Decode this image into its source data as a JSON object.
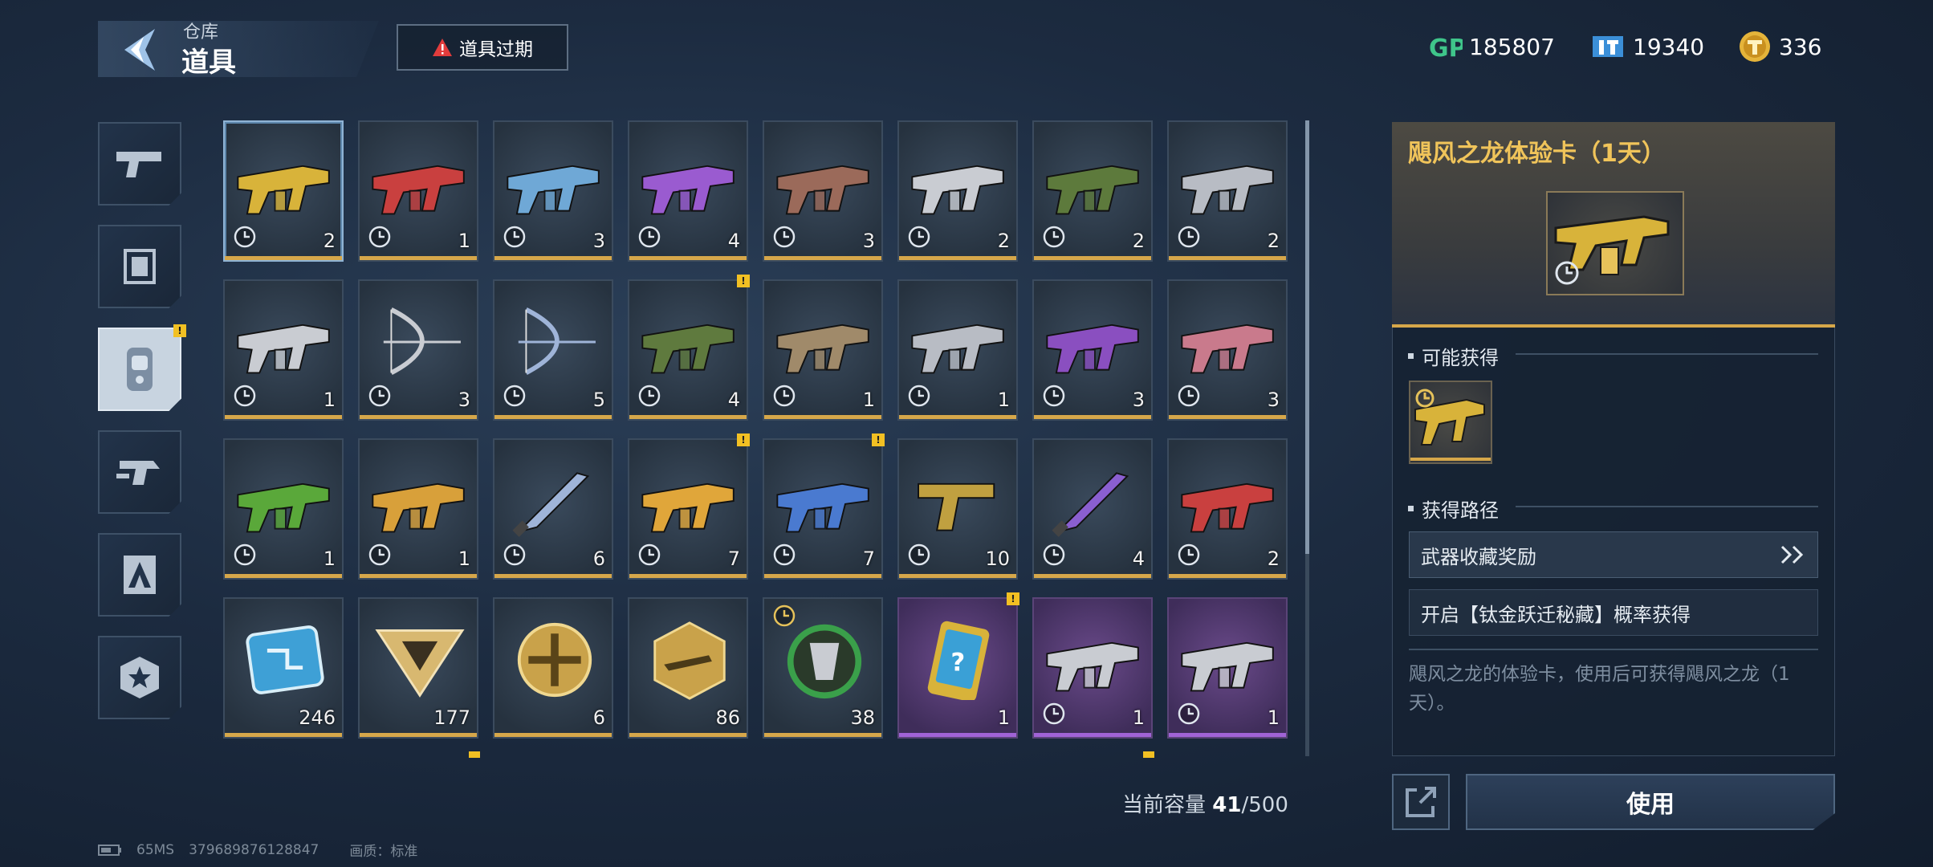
{
  "header": {
    "crumb_parent": "仓库",
    "crumb_current": "道具",
    "expire_button": "道具过期",
    "currencies": [
      {
        "icon": "gp-icon",
        "value": "185807"
      },
      {
        "icon": "ticket-icon",
        "value": "19340"
      },
      {
        "icon": "gold-coin-icon",
        "value": "336"
      }
    ]
  },
  "sidebar": {
    "tabs": [
      {
        "icon": "pistol-icon"
      },
      {
        "icon": "skin-frame-icon"
      },
      {
        "icon": "item-card-icon",
        "active": true
      },
      {
        "icon": "spray-icon"
      },
      {
        "icon": "profile-card-icon"
      },
      {
        "icon": "star-badge-icon"
      }
    ]
  },
  "grid": {
    "items": [
      {
        "kind": "gun",
        "color": "#d8b33a",
        "count": "2",
        "selected": true
      },
      {
        "kind": "gun",
        "color": "#c9403f",
        "count": "1"
      },
      {
        "kind": "gun",
        "color": "#6fa8d6",
        "count": "3"
      },
      {
        "kind": "gun",
        "color": "#9a5bd0",
        "count": "4"
      },
      {
        "kind": "gun",
        "color": "#9b6a5a",
        "count": "3"
      },
      {
        "kind": "gun",
        "color": "#c9ccd2",
        "count": "2"
      },
      {
        "kind": "gun",
        "color": "#5d7a3c",
        "count": "2"
      },
      {
        "kind": "gun",
        "color": "#b8bcc4",
        "count": "2"
      },
      {
        "kind": "gun",
        "color": "#c9ccd2",
        "count": "1"
      },
      {
        "kind": "bow",
        "color": "#c9ccd2",
        "count": "3"
      },
      {
        "kind": "bow",
        "color": "#9fb4d8",
        "count": "5"
      },
      {
        "kind": "gun",
        "color": "#5f7a3e",
        "count": "4",
        "notif": true
      },
      {
        "kind": "gun",
        "color": "#a08a6a",
        "count": "1"
      },
      {
        "kind": "gun",
        "color": "#b8bcc4",
        "count": "1"
      },
      {
        "kind": "gun",
        "color": "#8a4fc0",
        "count": "3"
      },
      {
        "kind": "gun",
        "color": "#c97a8c",
        "count": "3"
      },
      {
        "kind": "gun",
        "color": "#5aa83a",
        "count": "1"
      },
      {
        "kind": "gun",
        "color": "#d8a03a",
        "count": "1"
      },
      {
        "kind": "knife",
        "color": "#9fb4d8",
        "count": "6"
      },
      {
        "kind": "gun",
        "color": "#e0a63a",
        "count": "7",
        "notif": true
      },
      {
        "kind": "gun",
        "color": "#4a7ad0",
        "count": "7",
        "notif": true
      },
      {
        "kind": "pistol",
        "color": "#c0a040",
        "count": "10"
      },
      {
        "kind": "knife",
        "color": "#8a5fd0",
        "count": "4"
      },
      {
        "kind": "gun",
        "color": "#c9403f",
        "count": "2"
      },
      {
        "kind": "chip",
        "color": "#3ea0d6",
        "count": "246",
        "noclock": true
      },
      {
        "kind": "triangle",
        "color": "#d8b870",
        "count": "177",
        "noclock": true
      },
      {
        "kind": "coin",
        "color": "#c9a24a",
        "count": "6",
        "noclock": true
      },
      {
        "kind": "hexbadge",
        "color": "#c9a24a",
        "count": "86",
        "noclock": true
      },
      {
        "kind": "emblem",
        "color": "#3aa04a",
        "count": "38",
        "topclock": true
      },
      {
        "kind": "mystery",
        "color": "#3aa0d6",
        "count": "1",
        "purple": true,
        "notif": true,
        "noclock": true
      },
      {
        "kind": "gun",
        "color": "#c9ccd2",
        "count": "1",
        "purple": true
      },
      {
        "kind": "gun",
        "color": "#c9ccd2",
        "count": "1",
        "purple": true
      }
    ],
    "capacity_label": "当前容量",
    "capacity_used": "41",
    "capacity_total": "/500"
  },
  "detail": {
    "title": "飓风之龙体验卡（1天）",
    "possible_label": "可能获得",
    "source_label": "获得路径",
    "routes": [
      "武器收藏奖励",
      "开启【钛金跃迁秘藏】概率获得"
    ],
    "description": "飓风之龙的体验卡，使用后可获得飓风之龙（1天）。",
    "use_button": "使用"
  },
  "footer": {
    "ping": "65MS",
    "uid": "379689876128847",
    "quality_label": "画质：",
    "quality_value": "标准"
  },
  "colors": {
    "accent_gold": "#d6a74a",
    "title_gold": "#f0c45a",
    "rarity_purple": "#a063d6",
    "notify_yellow": "#f2c023",
    "gp_green": "#3fc58a",
    "ticket_blue": "#3b8fd8"
  }
}
